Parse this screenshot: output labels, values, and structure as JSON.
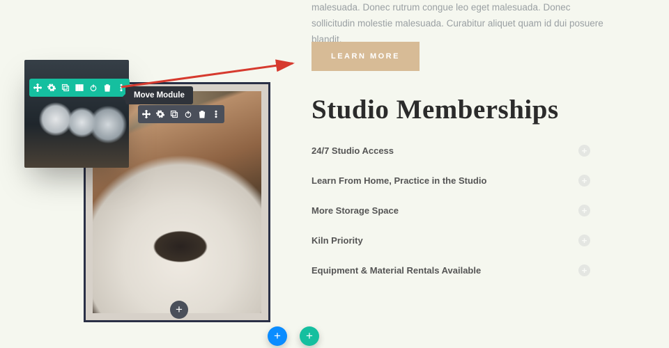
{
  "intro": {
    "text": "malesuada. Donec rutrum congue leo eget malesuada. Donec sollicitudin molestie malesuada. Curabitur aliquet quam id dui posuere blandit."
  },
  "cta": {
    "label": "LEARN MORE"
  },
  "section": {
    "heading": "Studio Memberships"
  },
  "accordion": {
    "items": [
      {
        "label": "24/7 Studio Access"
      },
      {
        "label": "Learn From Home, Practice in the Studio"
      },
      {
        "label": "More Storage Space"
      },
      {
        "label": "Kiln Priority"
      },
      {
        "label": "Equipment & Material Rentals Available"
      }
    ]
  },
  "builder": {
    "tooltip": "Move Module",
    "toolbar_icons": [
      "move",
      "settings",
      "duplicate",
      "columns",
      "power",
      "delete",
      "more"
    ]
  }
}
